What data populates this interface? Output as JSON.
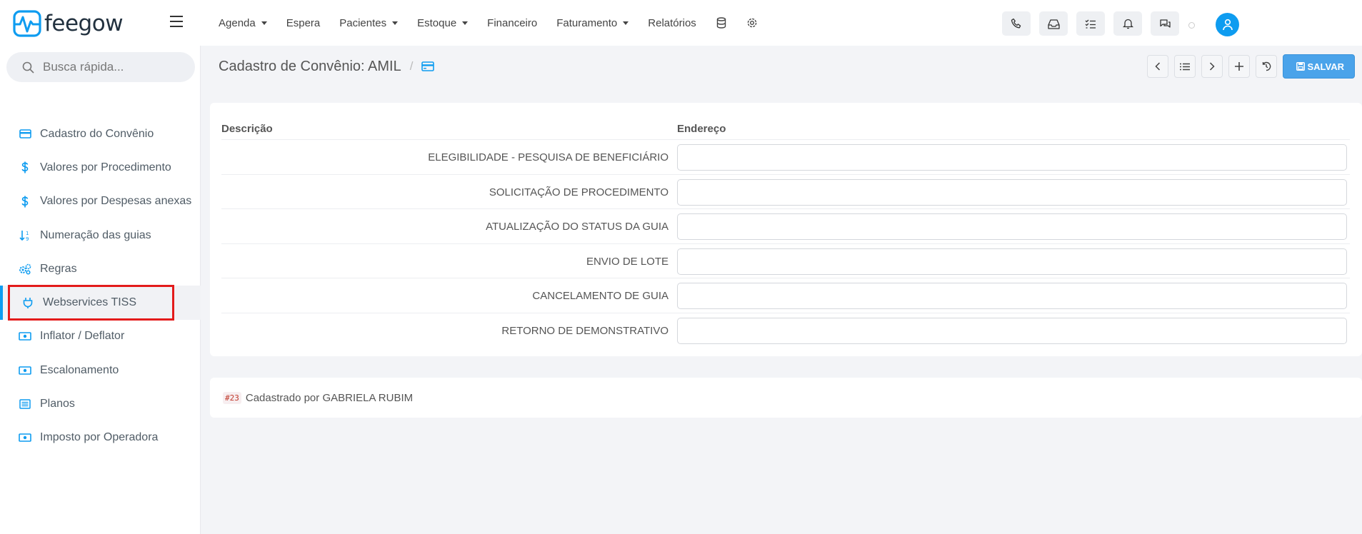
{
  "brand": {
    "name": "feegow",
    "color": "#0e9cf0"
  },
  "nav": {
    "items": [
      {
        "label": "Agenda",
        "dropdown": true
      },
      {
        "label": "Espera",
        "dropdown": false
      },
      {
        "label": "Pacientes",
        "dropdown": true
      },
      {
        "label": "Estoque",
        "dropdown": true
      },
      {
        "label": "Financeiro",
        "dropdown": false
      },
      {
        "label": "Faturamento",
        "dropdown": true
      },
      {
        "label": "Relatórios",
        "dropdown": false
      }
    ],
    "icons": [
      "database-icon",
      "gear-icon"
    ],
    "actions": [
      "phone-icon",
      "inbox-icon",
      "checklist-icon",
      "bell-icon",
      "chat-icon"
    ]
  },
  "search": {
    "placeholder": "Busca rápida..."
  },
  "sidebar": {
    "items": [
      {
        "label": "Cadastro do Convênio",
        "icon": "card-icon",
        "active": false
      },
      {
        "label": "Valores por Procedimento",
        "icon": "dollar-icon",
        "active": false
      },
      {
        "label": "Valores por Despesas anexas",
        "icon": "dollar-icon",
        "active": false
      },
      {
        "label": "Numeração das guias",
        "icon": "sort-numeric-icon",
        "active": false
      },
      {
        "label": "Regras",
        "icon": "cogs-icon",
        "active": false
      },
      {
        "label": "Webservices TISS",
        "icon": "plug-icon",
        "active": true
      },
      {
        "label": "Inflator / Deflator",
        "icon": "money-icon",
        "active": false
      },
      {
        "label": "Escalonamento",
        "icon": "money-icon",
        "active": false
      },
      {
        "label": "Planos",
        "icon": "list-alt-icon",
        "active": false
      },
      {
        "label": "Imposto por Operadora",
        "icon": "money-icon",
        "active": false
      }
    ]
  },
  "header": {
    "title": "Cadastro de Convênio: AMIL",
    "separator": "/",
    "save_label": "SALVAR",
    "save_color": "#4aa3ea"
  },
  "table": {
    "columns": [
      "Descrição",
      "Endereço"
    ],
    "rows": [
      {
        "label": "ELEGIBILIDADE - PESQUISA DE BENEFICIÁRIO",
        "value": ""
      },
      {
        "label": "SOLICITAÇÃO DE PROCEDIMENTO",
        "value": ""
      },
      {
        "label": "ATUALIZAÇÃO DO STATUS DA GUIA",
        "value": ""
      },
      {
        "label": "ENVIO DE LOTE",
        "value": ""
      },
      {
        "label": "CANCELAMENTO DE GUIA",
        "value": ""
      },
      {
        "label": "RETORNO DE DEMONSTRATIVO",
        "value": ""
      }
    ]
  },
  "footer": {
    "id": "#23",
    "text": "Cadastrado por GABRIELA RUBIM"
  }
}
